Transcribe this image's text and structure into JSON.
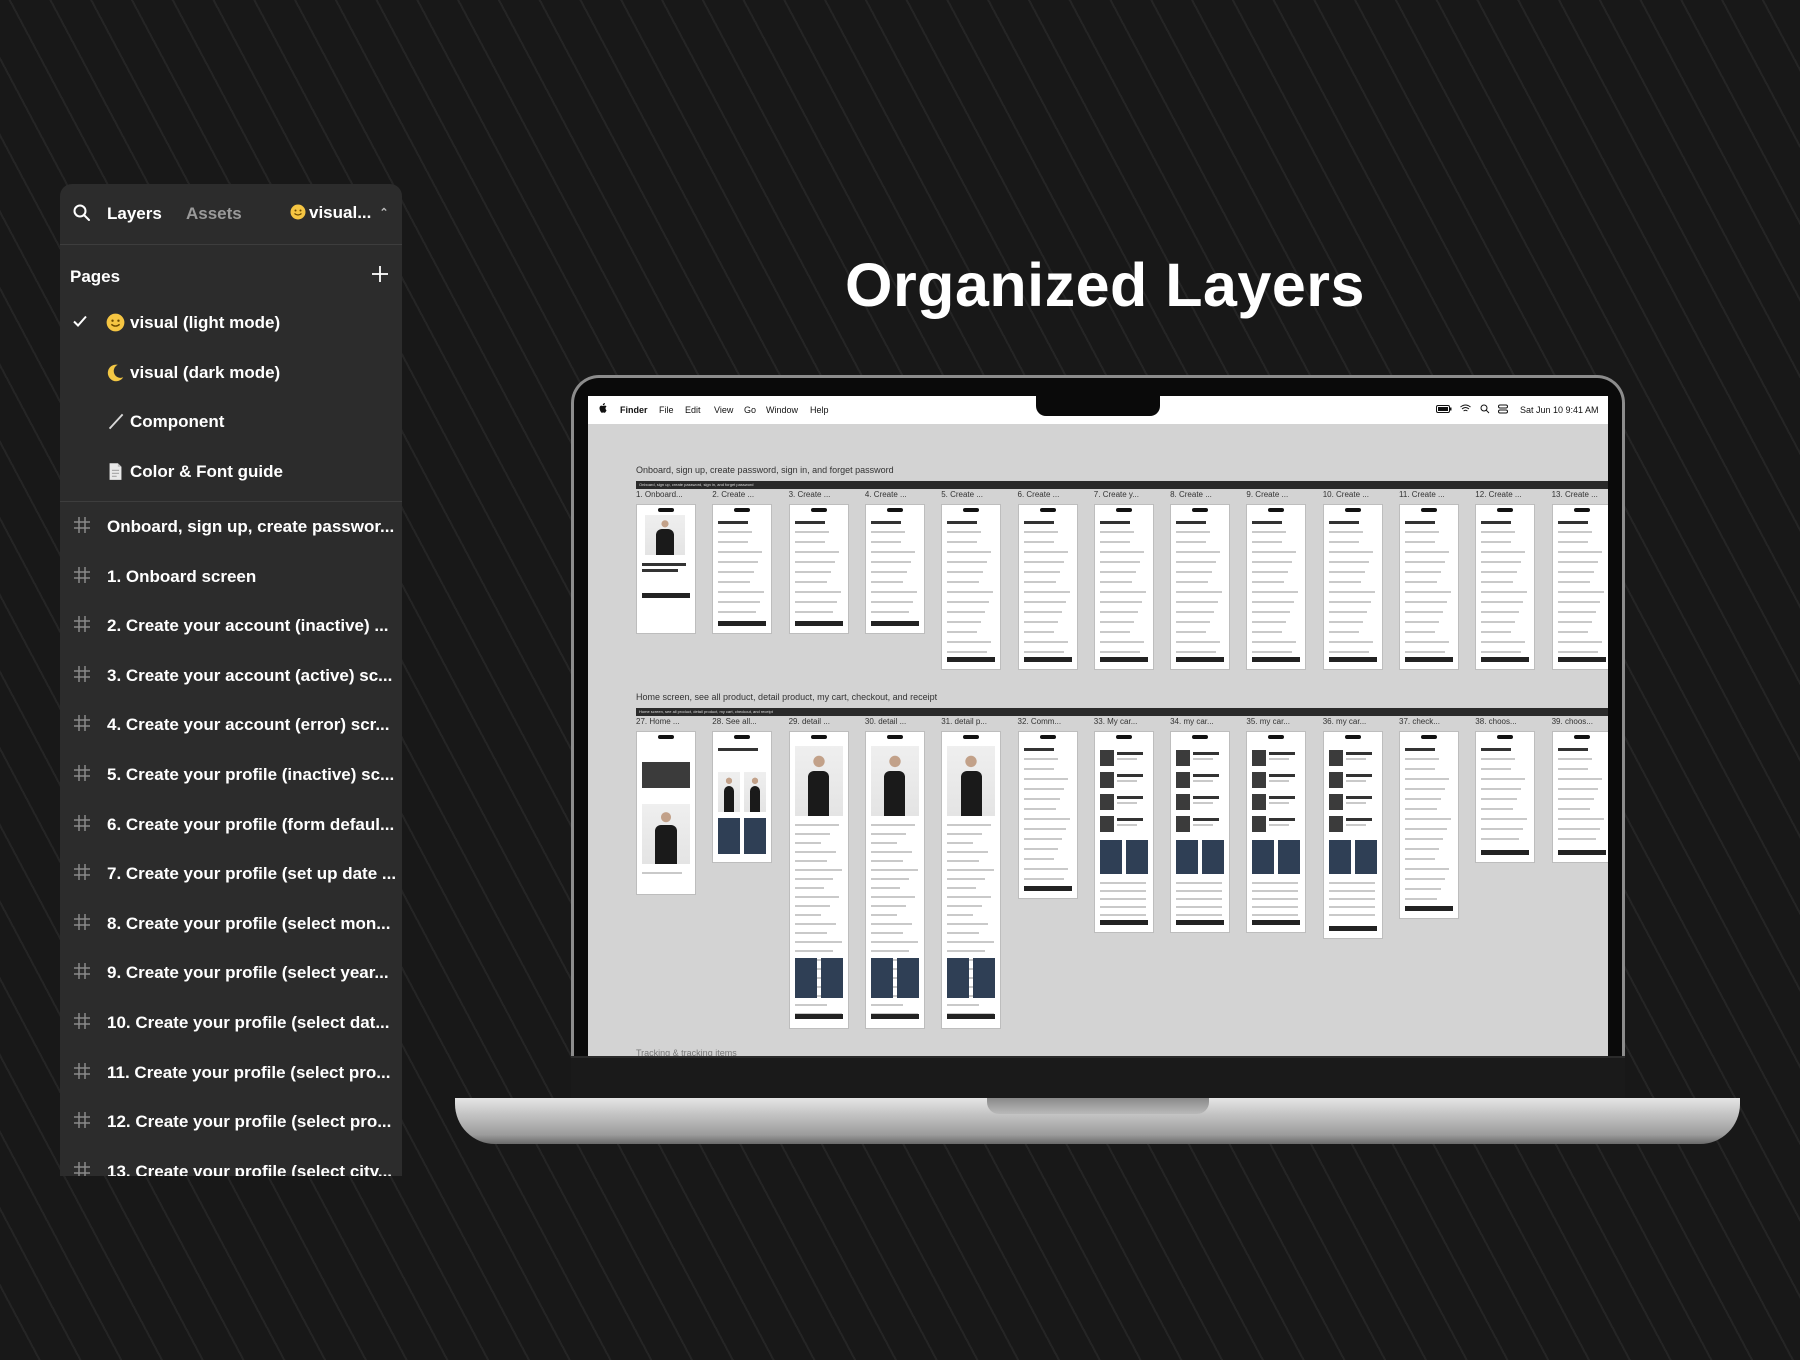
{
  "panel": {
    "tabs": {
      "layers": "Layers",
      "assets": "Assets"
    },
    "current_page": "visual...",
    "pages_title": "Pages",
    "pages": [
      {
        "label": "visual (light mode)",
        "icon": "smiley-emoji-icon",
        "selected": true
      },
      {
        "label": "visual (dark mode)",
        "icon": "crescent-moon-icon",
        "selected": false
      },
      {
        "label": "Component",
        "icon": "pencil-slash-icon",
        "selected": false
      },
      {
        "label": "Color & Font guide",
        "icon": "document-icon",
        "selected": false
      }
    ],
    "layers": [
      "Onboard, sign up, create passwor...",
      "1. Onboard screen",
      "2. Create your account (inactive) ...",
      "3. Create your account (active) sc...",
      "4. Create your account (error) scr...",
      "5. Create your profile (inactive) sc...",
      "6. Create your profile (form defaul...",
      "7. Create your profile (set up date ...",
      "8. Create your profile (select mon...",
      "9. Create your profile (select year...",
      "10. Create your profile (select dat...",
      "11. Create your profile (select pro...",
      "12. Create your profile (select pro...",
      "13. Create your profile (select city..."
    ]
  },
  "title": "Organized Layers",
  "laptop": {
    "menubar": {
      "menus": [
        "Finder",
        "File",
        "Edit",
        "View",
        "Go",
        "Window",
        "Help"
      ],
      "datetime": "Sat Jun 10  9:41 AM"
    },
    "section1": {
      "label": "Onboard, sign up, create password, sign in, and forget password",
      "bar": "Onboard, sign up, create password, sign in, and forget password",
      "frames": [
        "1. Onboard...",
        "2. Create ...",
        "3. Create ...",
        "4. Create ...",
        "5. Create ...",
        "6. Create ...",
        "7. Create y...",
        "8. Create ...",
        "9. Create ...",
        "10. Create ...",
        "11. Create ...",
        "12. Create ...",
        "13. Create ..."
      ]
    },
    "section2": {
      "label": "Home screen, see all product, detail product, my cart, checkout, and receipt",
      "bar": "Home screen, see all product, detail product, my cart, checkout, and receipt",
      "frames": [
        "27. Home ...",
        "28. See all...",
        "29. detail ...",
        "30. detail ...",
        "31. detail p...",
        "32. Comm...",
        "33. My car...",
        "34. my car...",
        "35. my car...",
        "36. my car...",
        "37. check...",
        "38. choos...",
        "39. choos..."
      ]
    },
    "section3": {
      "label": "Tracking & tracking items"
    }
  }
}
